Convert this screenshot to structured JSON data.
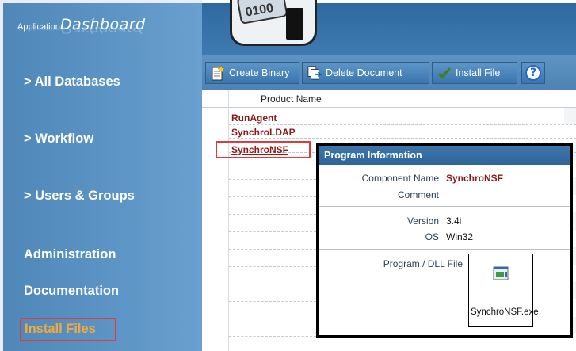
{
  "logo": {
    "small": "Application",
    "big": "Dashboard"
  },
  "sidebar": {
    "items": [
      {
        "label": "> All Databases"
      },
      {
        "label": "> Workflow"
      },
      {
        "label": "> Users & Groups"
      },
      {
        "label": "Administration"
      },
      {
        "label": "Documentation"
      },
      {
        "label": "Install Files"
      }
    ],
    "active_index": 5
  },
  "header": {
    "disk_label": "0100"
  },
  "toolbar": {
    "create_binary": "Create Binary",
    "delete_document": "Delete Document",
    "install_file": "Install File",
    "help_symbol": "?"
  },
  "list": {
    "column_header": "Product Name",
    "rows": [
      "RunAgent",
      "SynchroLDAP",
      "SynchroNSF"
    ],
    "selected_index": 2
  },
  "popup": {
    "title": "Program Information",
    "component_label": "Component Name",
    "component_value": "SynchroNSF",
    "comment_label": "Comment",
    "comment_value": "",
    "version_label": "Version",
    "version_value": "3.4i",
    "os_label": "OS",
    "os_value": "Win32",
    "file_label": "Program / DLL File",
    "file_name": "SynchroNSF.exe"
  },
  "colors": {
    "sidebar": "#5b94c5",
    "active_nav": "#f4a93c",
    "highlight": "#e03a3a",
    "row_text": "#8b1a1a"
  },
  "icons": [
    "create-binary-icon",
    "delete-document-icon",
    "install-file-icon",
    "help-icon",
    "exe-file-icon"
  ]
}
